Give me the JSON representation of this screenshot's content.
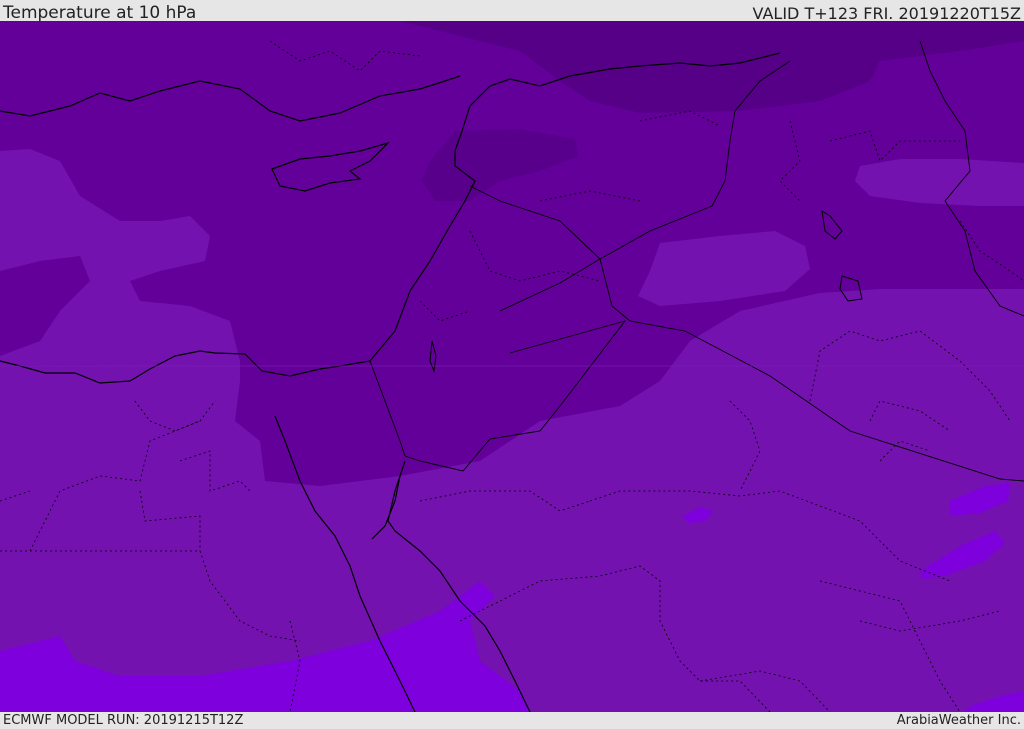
{
  "header": {
    "title": "Temperature at 10 hPa",
    "valid": "VALID T+123 FRI. 20191220T15Z"
  },
  "footer": {
    "model_run": "ECMWF MODEL RUN: 20191215T12Z",
    "credit": "ArabiaWeather Inc."
  },
  "map": {
    "field_colors": {
      "darkest": "#5a0090",
      "dark": "#63009a",
      "mid": "#6a00a2",
      "light": "#7412b0",
      "bright": "#7d00dd"
    },
    "coastline_color": "#000000",
    "border_style": "dotted"
  }
}
